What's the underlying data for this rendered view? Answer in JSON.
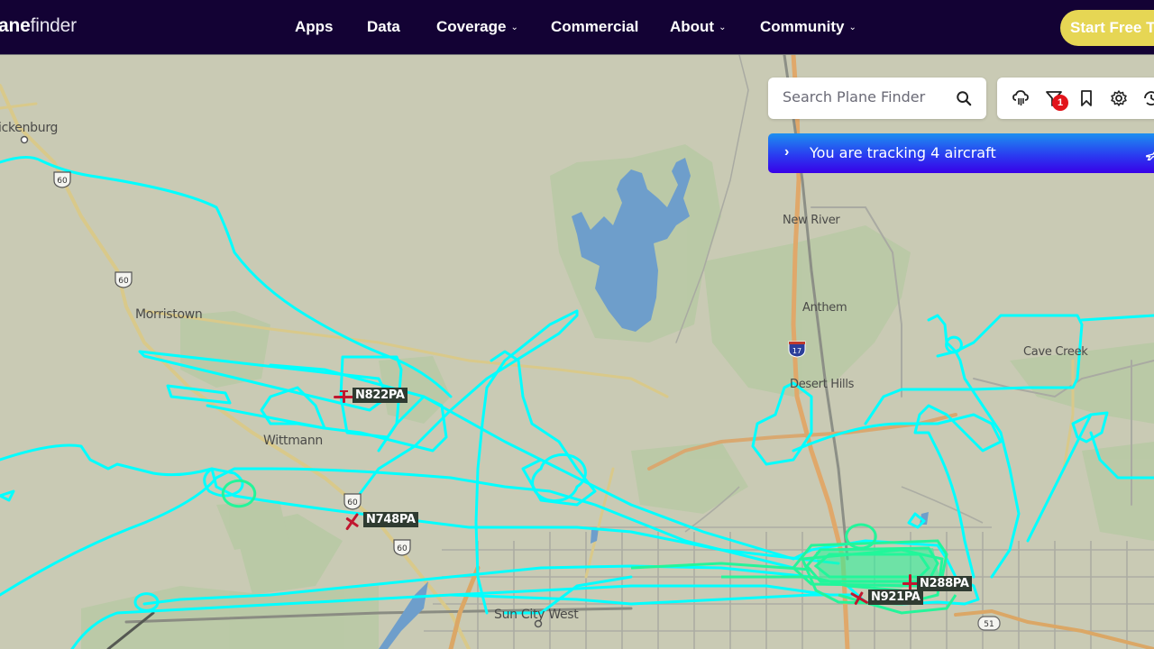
{
  "navbar": {
    "logo_bold": "ane",
    "logo_light": "finder",
    "items": [
      {
        "label": "Apps",
        "has_dropdown": false
      },
      {
        "label": "Data",
        "has_dropdown": false
      },
      {
        "label": "Coverage",
        "has_dropdown": true
      },
      {
        "label": "Commercial",
        "has_dropdown": false
      },
      {
        "label": "About",
        "has_dropdown": true
      },
      {
        "label": "Community",
        "has_dropdown": true
      }
    ],
    "chevron": "⌄",
    "cta_label": "Start Free Trial",
    "cta_color": "#e6d654",
    "bg_color": "#130234"
  },
  "search": {
    "placeholder": "Search Plane Finder",
    "value": "",
    "icon": "search-icon"
  },
  "toolbar": {
    "icons": [
      "weather-cloud-icon",
      "filter-icon",
      "bookmark-icon",
      "settings-gear-icon",
      "history-clock-icon"
    ],
    "filter_badge_count": "1",
    "badge_color": "#e2141b"
  },
  "tracking_banner": {
    "chevron": "›",
    "text": "You are tracking 4 aircraft",
    "icon": "plane-icon"
  },
  "map": {
    "places": [
      {
        "name": "ickenburg"
      },
      {
        "name": "Morristown"
      },
      {
        "name": "Wittmann"
      },
      {
        "name": "New River"
      },
      {
        "name": "Anthem"
      },
      {
        "name": "Desert Hills"
      },
      {
        "name": "Cave Creek"
      },
      {
        "name": "Sun City West"
      }
    ],
    "route_shields": [
      "60",
      "60",
      "60",
      "60",
      "17",
      "51"
    ],
    "track_color": "#00ffff",
    "track_color_alt": "#23f59a",
    "aircraft_color": "#c0172f"
  },
  "aircraft": [
    {
      "callsign": "N822PA"
    },
    {
      "callsign": "N748PA"
    },
    {
      "callsign": "N288PA"
    },
    {
      "callsign": "N921PA"
    }
  ]
}
